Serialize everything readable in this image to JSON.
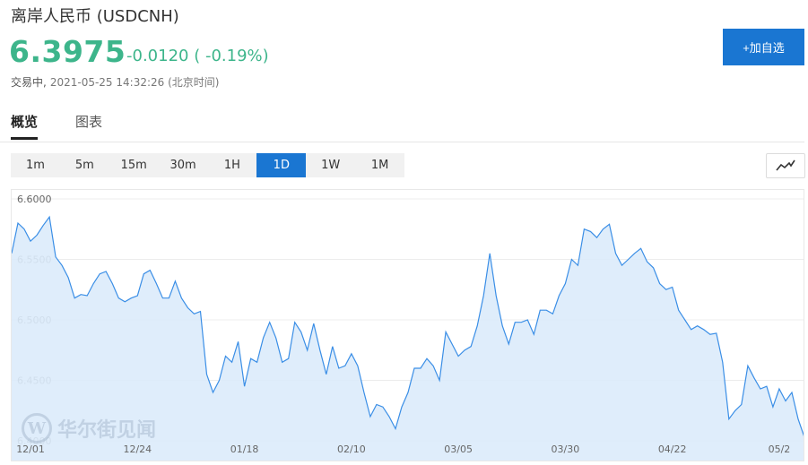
{
  "header": {
    "title": "离岸人民币  (USDCNH)",
    "price": "6.3975",
    "change": "-0.0120 ( -0.19%)",
    "status": "交易中,",
    "timestamp": "2021-05-25 14:32:26 (北京时间)",
    "add_label": "+加自选"
  },
  "tabs": [
    {
      "label": "概览",
      "active": true
    },
    {
      "label": "图表",
      "active": false
    }
  ],
  "periods": [
    {
      "label": "1m"
    },
    {
      "label": "5m"
    },
    {
      "label": "15m"
    },
    {
      "label": "30m"
    },
    {
      "label": "1H"
    },
    {
      "label": "1D",
      "active": true
    },
    {
      "label": "1W"
    },
    {
      "label": "1M"
    }
  ],
  "chart_type_icon": "line-chart-icon",
  "watermark": {
    "logo": "W",
    "text": "华尔街见闻"
  },
  "colors": {
    "accent": "#1a76d2",
    "price_down": "#3db58b",
    "line": "#3a8ee6",
    "area": "#dcebfb"
  },
  "chart_data": {
    "type": "area",
    "ylim": [
      6.4,
      6.6
    ],
    "y_ticks": [
      "6.6000",
      "6.5500",
      "6.5000",
      "6.4500",
      "6.4000"
    ],
    "x_ticks": [
      {
        "label": "12/01",
        "index": 3
      },
      {
        "label": "12/24",
        "index": 20
      },
      {
        "label": "01/18",
        "index": 37
      },
      {
        "label": "02/10",
        "index": 54
      },
      {
        "label": "03/05",
        "index": 71
      },
      {
        "label": "03/30",
        "index": 88
      },
      {
        "label": "04/22",
        "index": 105
      },
      {
        "label": "05/2",
        "index": 122
      }
    ],
    "values": [
      6.555,
      6.58,
      6.575,
      6.565,
      6.57,
      6.578,
      6.585,
      6.552,
      6.545,
      6.535,
      6.518,
      6.521,
      6.52,
      6.53,
      6.538,
      6.54,
      6.53,
      6.518,
      6.515,
      6.518,
      6.52,
      6.538,
      6.541,
      6.53,
      6.518,
      6.518,
      6.532,
      6.518,
      6.51,
      6.505,
      6.507,
      6.455,
      6.44,
      6.45,
      6.47,
      6.465,
      6.482,
      6.445,
      6.468,
      6.465,
      6.485,
      6.498,
      6.485,
      6.465,
      6.468,
      6.498,
      6.49,
      6.475,
      6.497,
      6.475,
      6.455,
      6.478,
      6.46,
      6.462,
      6.472,
      6.462,
      6.44,
      6.42,
      6.43,
      6.428,
      6.42,
      6.41,
      6.428,
      6.44,
      6.46,
      6.46,
      6.468,
      6.462,
      6.45,
      6.49,
      6.48,
      6.47,
      6.475,
      6.478,
      6.495,
      6.52,
      6.555,
      6.52,
      6.495,
      6.48,
      6.498,
      6.498,
      6.5,
      6.488,
      6.508,
      6.508,
      6.505,
      6.52,
      6.53,
      6.55,
      6.545,
      6.575,
      6.573,
      6.568,
      6.575,
      6.579,
      6.555,
      6.545,
      6.55,
      6.555,
      6.559,
      6.548,
      6.543,
      6.53,
      6.525,
      6.527,
      6.508,
      6.5,
      6.492,
      6.495,
      6.492,
      6.488,
      6.489,
      6.465,
      6.418,
      6.425,
      6.43,
      6.462,
      6.452,
      6.443,
      6.445,
      6.428,
      6.443,
      6.433,
      6.44,
      6.418,
      6.403
    ]
  }
}
